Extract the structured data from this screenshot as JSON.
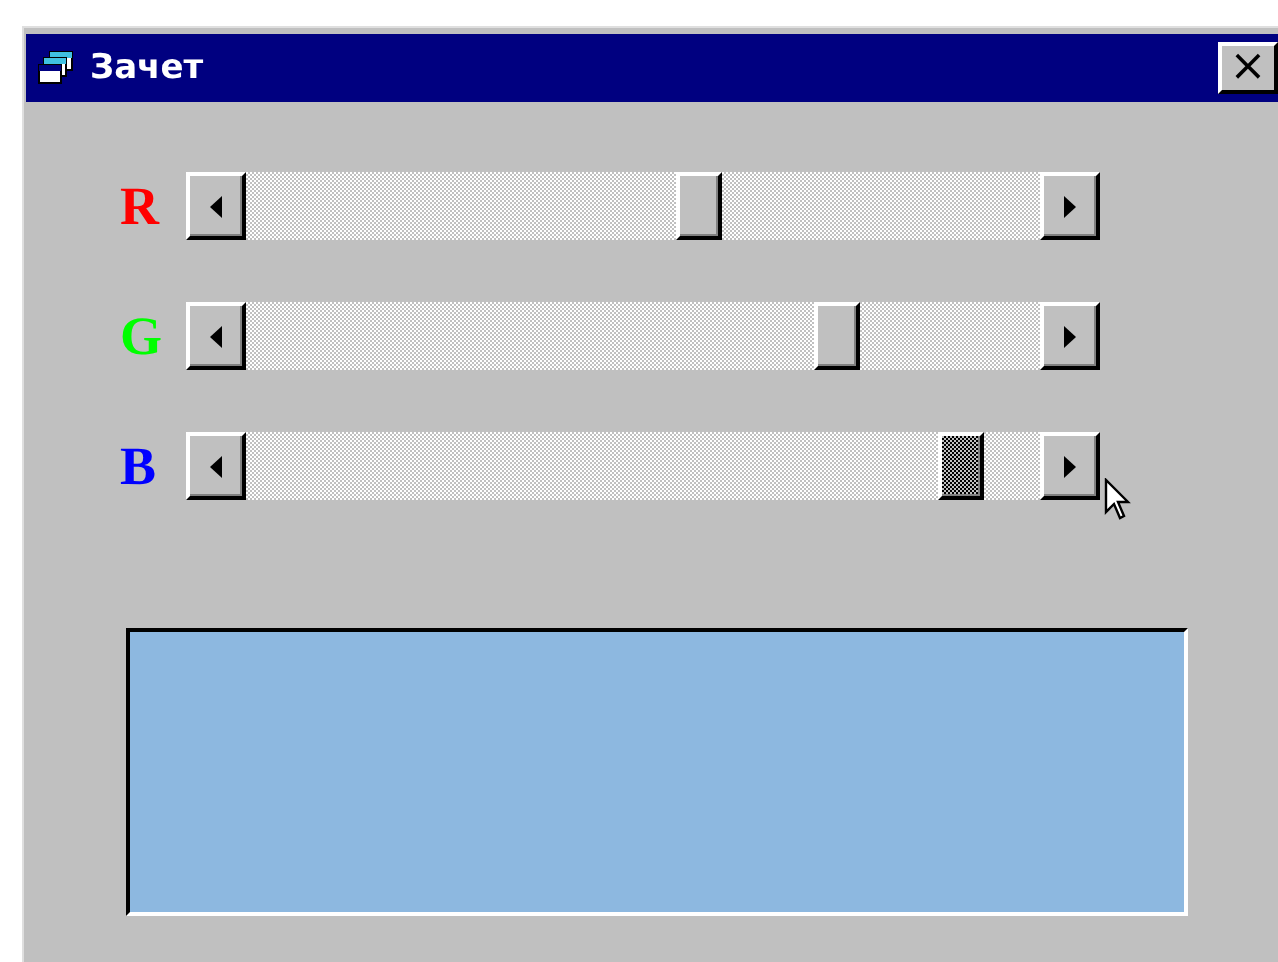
{
  "window": {
    "title": "Зачет",
    "close": "×"
  },
  "channels": [
    {
      "label": "R",
      "color": "#ff0000",
      "level": 0.575,
      "focused": false
    },
    {
      "label": "G",
      "color": "#00ff00",
      "level": 0.76,
      "focused": false
    },
    {
      "label": "B",
      "color": "#0000ff",
      "level": 0.925,
      "focused": true
    }
  ],
  "preview": {
    "color": "#8db8e0"
  }
}
